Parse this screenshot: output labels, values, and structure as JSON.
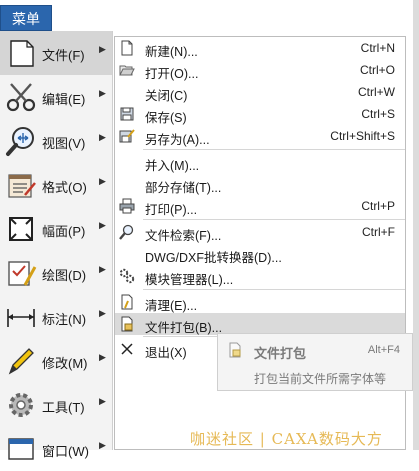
{
  "menu_button": "菜单",
  "categories": [
    {
      "label": "文件(F)",
      "icon": "blank-page-icon"
    },
    {
      "label": "编辑(E)",
      "icon": "scissors-icon"
    },
    {
      "label": "视图(V)",
      "icon": "zoom-icon"
    },
    {
      "label": "格式(O)",
      "icon": "format-icon"
    },
    {
      "label": "幅面(P)",
      "icon": "frame-icon"
    },
    {
      "label": "绘图(D)",
      "icon": "draw-icon"
    },
    {
      "label": "标注(N)",
      "icon": "dimension-icon"
    },
    {
      "label": "修改(M)",
      "icon": "modify-icon"
    },
    {
      "label": "工具(T)",
      "icon": "gear-icon"
    },
    {
      "label": "窗口(W)",
      "icon": "window-icon"
    }
  ],
  "file_menu": [
    {
      "label": "新建(N)...",
      "shortcut": "Ctrl+N",
      "icon": "new-file-icon"
    },
    {
      "label": "打开(O)...",
      "shortcut": "Ctrl+O",
      "icon": "open-folder-icon"
    },
    {
      "label": "关闭(C)",
      "shortcut": "Ctrl+W",
      "icon": ""
    },
    {
      "label": "保存(S)",
      "shortcut": "Ctrl+S",
      "icon": "save-icon"
    },
    {
      "label": "另存为(A)...",
      "shortcut": "Ctrl+Shift+S",
      "icon": "save-as-icon"
    },
    {
      "label": "并入(M)...",
      "shortcut": "",
      "icon": ""
    },
    {
      "label": "部分存储(T)...",
      "shortcut": "",
      "icon": ""
    },
    {
      "label": "打印(P)...",
      "shortcut": "Ctrl+P",
      "icon": "printer-icon"
    },
    {
      "label": "文件检索(F)...",
      "shortcut": "Ctrl+F",
      "icon": "file-search-icon"
    },
    {
      "label": "DWG/DXF批转换器(D)...",
      "shortcut": "",
      "icon": ""
    },
    {
      "label": "模块管理器(L)...",
      "shortcut": "",
      "icon": "module-manager-icon"
    },
    {
      "label": "清理(E)...",
      "shortcut": "",
      "icon": "cleanup-icon"
    },
    {
      "label": "文件打包(B)...",
      "shortcut": "",
      "icon": "package-icon"
    },
    {
      "label": "退出(X)",
      "shortcut": "",
      "icon": "close-icon"
    }
  ],
  "tooltip": {
    "title": "文件打包",
    "shortcut": "Alt+F4",
    "description": "打包当前文件所需字体等"
  },
  "watermark": "咖迷社区 | CAXA数码大方",
  "colors": {
    "accent": "#2b66ad",
    "highlight": "#dadada",
    "watermark": "#e6b955"
  }
}
